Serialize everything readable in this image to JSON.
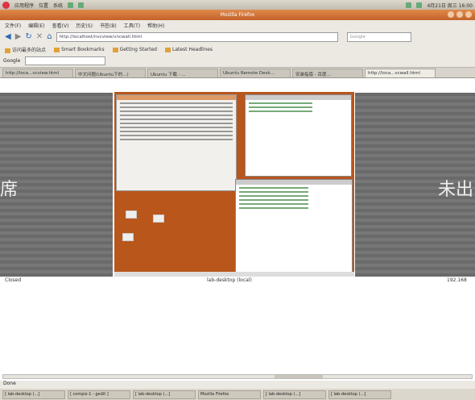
{
  "top_panel": {
    "menus": [
      "应用程序",
      "位置",
      "系统"
    ],
    "clock": "4月21日 周三 16:00"
  },
  "window": {
    "title": "Mozilla Firefox"
  },
  "menubar": [
    "文件(F)",
    "编辑(E)",
    "查看(V)",
    "历史(S)",
    "书签(B)",
    "工具(T)",
    "帮助(H)"
  ],
  "navbar": {
    "url": "http://localhost/nvcview/vncwall.html",
    "search_placeholder": "Google"
  },
  "bookmarks": [
    "访问最多的站点",
    "Smart Bookmarks",
    "Getting Started",
    "Latest Headlines"
  ],
  "googlebar": {
    "label": "Google"
  },
  "tabs": [
    {
      "label": "http://loca...vcview.html",
      "active": false
    },
    {
      "label": "中文问题(Ubuntu下的...)",
      "active": false
    },
    {
      "label": "Ubuntu 下载 - ...",
      "active": false
    },
    {
      "label": "Ubuntu Remote Desk...",
      "active": false
    },
    {
      "label": "安装指南 - 百度...",
      "active": false
    },
    {
      "label": "http://loca...vcwall.html",
      "active": true
    }
  ],
  "content": {
    "left_big_text": "席",
    "right_big_text": "未出",
    "caption_left": "Closed",
    "caption_center": "lab-desktop (local)",
    "caption_right": "192.168"
  },
  "status": "Done",
  "taskbar": [
    "[ lab-desktop (...]",
    "[ compiz-1 - gedit ]",
    "[ lab-desktop (...]",
    "Mozilla Firefox",
    "[ lab-desktop (...]",
    "[ lab-desktop (...]"
  ]
}
